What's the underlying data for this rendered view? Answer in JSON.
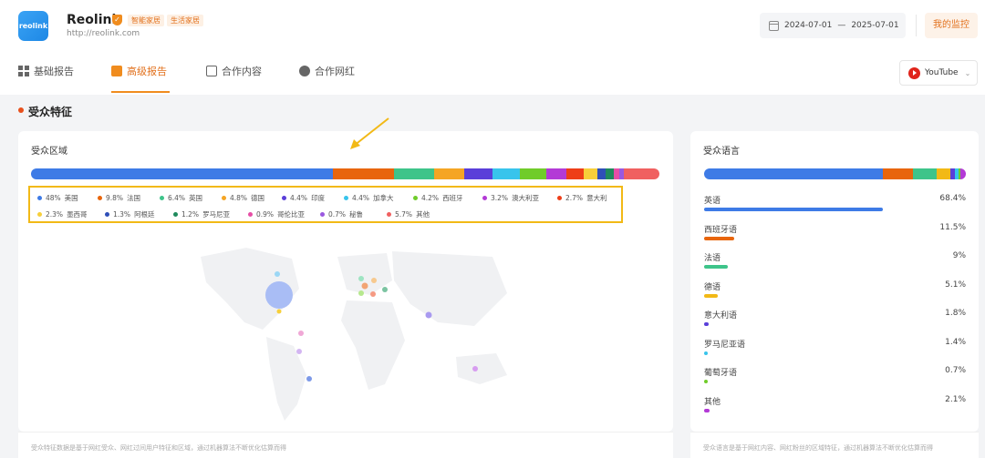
{
  "brand": {
    "logo_text": "reolink",
    "name": "Reolink",
    "url": "http://reolink.com",
    "tags": [
      "智能家居",
      "生活家居"
    ]
  },
  "header": {
    "date_start": "2024-07-01",
    "date_sep": "—",
    "date_end": "2025-07-01",
    "my_monitor": "我的监控"
  },
  "tabs": [
    {
      "label": "基础报告",
      "active": false
    },
    {
      "label": "高级报告",
      "active": true
    },
    {
      "label": "合作内容",
      "active": false
    },
    {
      "label": "合作网红",
      "active": false
    }
  ],
  "platform": {
    "label": "YouTube"
  },
  "section": {
    "title": "受众特征"
  },
  "region": {
    "title": "受众区域",
    "items": [
      {
        "pct": "48%",
        "label": "美国",
        "value": 48,
        "color": "#3e7be6"
      },
      {
        "pct": "9.8%",
        "label": "法国",
        "value": 9.8,
        "color": "#e8650c"
      },
      {
        "pct": "6.4%",
        "label": "英国",
        "value": 6.4,
        "color": "#3ec48a"
      },
      {
        "pct": "4.8%",
        "label": "德国",
        "value": 4.8,
        "color": "#f5a524"
      },
      {
        "pct": "4.4%",
        "label": "印度",
        "value": 4.4,
        "color": "#5a3fd9"
      },
      {
        "pct": "4.4%",
        "label": "加拿大",
        "value": 4.4,
        "color": "#38c4ec"
      },
      {
        "pct": "4.2%",
        "label": "西班牙",
        "value": 4.2,
        "color": "#70cc2a"
      },
      {
        "pct": "3.2%",
        "label": "澳大利亚",
        "value": 3.2,
        "color": "#b33ad6"
      },
      {
        "pct": "2.7%",
        "label": "意大利",
        "value": 2.7,
        "color": "#ee3e18"
      },
      {
        "pct": "2.3%",
        "label": "墨西哥",
        "value": 2.3,
        "color": "#f7cf3a"
      },
      {
        "pct": "1.3%",
        "label": "阿根廷",
        "value": 1.3,
        "color": "#2f4fb8"
      },
      {
        "pct": "1.2%",
        "label": "罗马尼亚",
        "value": 1.2,
        "color": "#1f8a5c"
      },
      {
        "pct": "0.9%",
        "label": "哥伦比亚",
        "value": 0.9,
        "color": "#e64ea6"
      },
      {
        "pct": "0.7%",
        "label": "秘鲁",
        "value": 0.7,
        "color": "#9a58e0"
      },
      {
        "pct": "5.7%",
        "label": "其他",
        "value": 5.7,
        "color": "#f06060"
      }
    ],
    "footnote": "受众特征数据是基于网红受众、网红过间用户特征和区域，通过机器算法不断优化估算而得"
  },
  "language": {
    "title": "受众语言",
    "items": [
      {
        "label": "英语",
        "pct": "68.4%",
        "value": 68.4,
        "color": "#3e7be6"
      },
      {
        "label": "西班牙语",
        "pct": "11.5%",
        "value": 11.5,
        "color": "#e8650c"
      },
      {
        "label": "法语",
        "pct": "9%",
        "value": 9,
        "color": "#3ec48a"
      },
      {
        "label": "德语",
        "pct": "5.1%",
        "value": 5.1,
        "color": "#f2b916"
      },
      {
        "label": "意大利语",
        "pct": "1.8%",
        "value": 1.8,
        "color": "#5a3fd9"
      },
      {
        "label": "罗马尼亚语",
        "pct": "1.4%",
        "value": 1.4,
        "color": "#38c4ec"
      },
      {
        "label": "葡萄牙语",
        "pct": "0.7%",
        "value": 0.7,
        "color": "#70cc2a"
      },
      {
        "label": "其他",
        "pct": "2.1%",
        "value": 2.1,
        "color": "#b33ad6"
      }
    ],
    "footnote": "受众语言是基于网红内容、网红粉丝的区域特征，通过机器算法不断优化估算而得"
  }
}
